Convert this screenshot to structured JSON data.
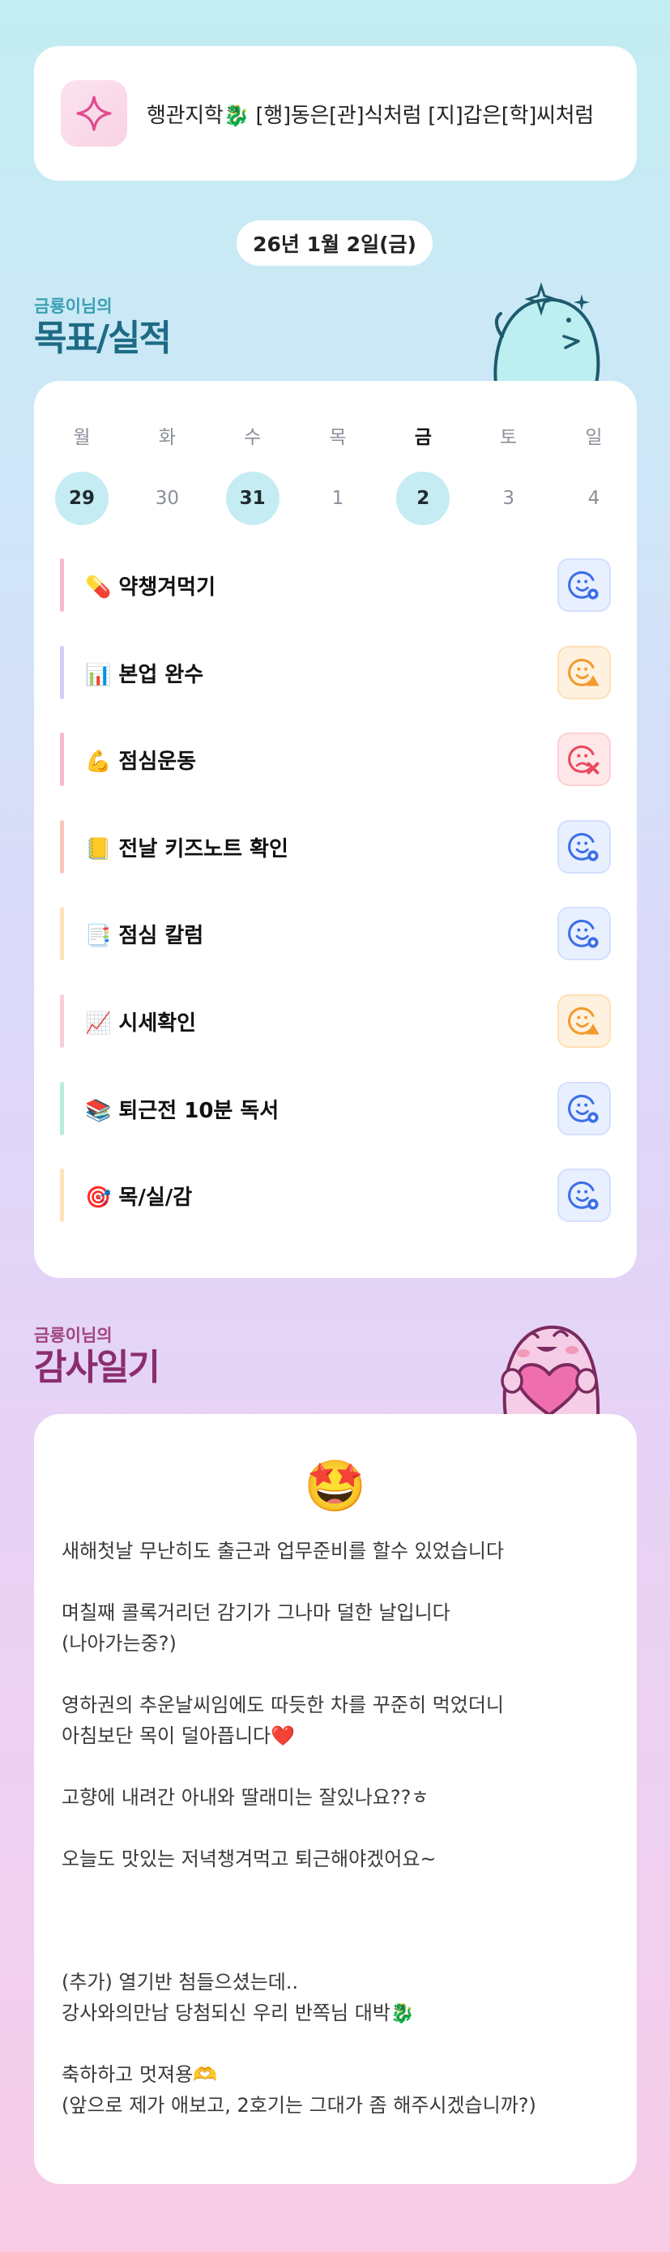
{
  "motto": {
    "text": "행관지학🐉 [행]동은[관]식처럼 [지]갑은[학]씨처럼"
  },
  "date": {
    "label": "26년 1월 2일(금)"
  },
  "goals": {
    "subtitle": "금룡이님의",
    "title": "목표/실적",
    "week": [
      {
        "day": "월",
        "num": "29",
        "done": true,
        "today": false
      },
      {
        "day": "화",
        "num": "30",
        "done": false,
        "today": false
      },
      {
        "day": "수",
        "num": "31",
        "done": true,
        "today": false
      },
      {
        "day": "목",
        "num": "1",
        "done": false,
        "today": false
      },
      {
        "day": "금",
        "num": "2",
        "done": true,
        "today": true
      },
      {
        "day": "토",
        "num": "3",
        "done": false,
        "today": false
      },
      {
        "day": "일",
        "num": "4",
        "done": false,
        "today": false
      }
    ],
    "tasks": [
      {
        "label": "💊 약챙겨먹기",
        "bar": "#f7b9cd",
        "status": "ok"
      },
      {
        "label": "📊 본업 완수",
        "bar": "#d6cdf6",
        "status": "warn"
      },
      {
        "label": "💪 점심운동",
        "bar": "#f7b9cd",
        "status": "bad"
      },
      {
        "label": "📒 전날 키즈노트 확인",
        "bar": "#f9c7bf",
        "status": "ok"
      },
      {
        "label": "📑 점심 칼럼",
        "bar": "#fde3b7",
        "status": "ok"
      },
      {
        "label": "📈 시세확인",
        "bar": "#f9cfd6",
        "status": "warn"
      },
      {
        "label": "📚 퇴근전 10분 독서",
        "bar": "#b9ecd9",
        "status": "ok"
      },
      {
        "label": "🎯 목/실/감",
        "bar": "#fde3b7",
        "status": "ok"
      }
    ],
    "status_colors": {
      "ok": "#3d6fe6",
      "warn": "#f29a2e",
      "bad": "#e84a5f"
    }
  },
  "gratitude": {
    "subtitle": "금룡이님의",
    "title": "감사일기",
    "emoji": "🤩",
    "lines": [
      "새해첫날 무난히도 출근과 업무준비를 할수 있었습니다",
      "",
      "며칠째 콜록거리던 감기가 그나마 덜한 날입니다",
      "(나아가는중?)",
      "",
      "영하권의 추운날씨임에도 따듯한 차를 꾸준히 먹었더니",
      "아침보단 목이 덜아픕니다❤️",
      "",
      "고향에 내려간 아내와 딸래미는 잘있나요??ㅎ",
      "",
      "오늘도 맛있는 저녁챙겨먹고 퇴근해야겠어요~",
      "",
      "",
      "",
      "(추가) 열기반 첨들으셨는데..",
      "강사와의만남 당첨되신 우리 반쪽님 대박🐉",
      "",
      "축하하고 멋져용🫶",
      "(앞으로 제가 애보고, 2호기는 그대가 좀 해주시겠습니까?)"
    ]
  }
}
